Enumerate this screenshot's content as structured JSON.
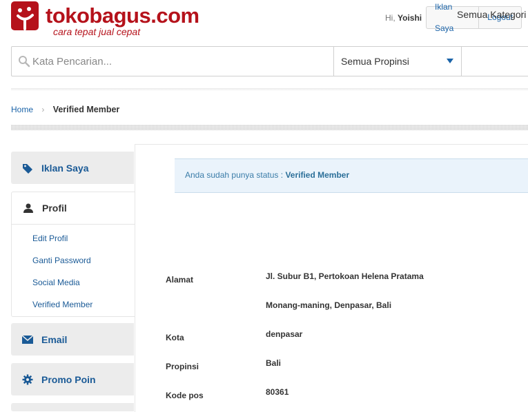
{
  "header": {
    "brand": "tokobagus.com",
    "tagline": "cara tepat jual cepat",
    "greeting_prefix": "Hi,",
    "username": "Yoishi",
    "my_ads_link": "Iklan Saya",
    "logout_link": "Logout",
    "brand_color": "#b5121b"
  },
  "search": {
    "placeholder": "Kata Pencarian...",
    "province_value": "Semua Propinsi",
    "category_value": "Semua Kategori"
  },
  "breadcrumb": {
    "home": "Home",
    "current": "Verified Member"
  },
  "sidebar": {
    "tabs": [
      {
        "label": "Iklan Saya",
        "icon": "tag-icon"
      },
      {
        "label": "Profil",
        "icon": "user-icon"
      },
      {
        "label": "Email",
        "icon": "envelope-icon"
      },
      {
        "label": "Promo Poin",
        "icon": "gear-icon"
      }
    ],
    "profile_items": [
      "Edit Profil",
      "Ganti Password",
      "Social Media",
      "Verified Member"
    ]
  },
  "notice": {
    "text": "Anda sudah punya status : ",
    "status": "Verified Member"
  },
  "info": {
    "address_label": "Alamat",
    "address_line1": "Jl. Subur B1, Pertokoan Helena Pratama",
    "address_line2": "Monang-maning, Denpasar, Bali",
    "city_label": "Kota",
    "city_value": "denpasar",
    "province_label": "Propinsi",
    "province_value": "Bali",
    "postcode_label": "Kode pos",
    "postcode_value": "80361"
  },
  "colors": {
    "link": "#1a63a8",
    "notice_bg": "#eaf3fb"
  }
}
